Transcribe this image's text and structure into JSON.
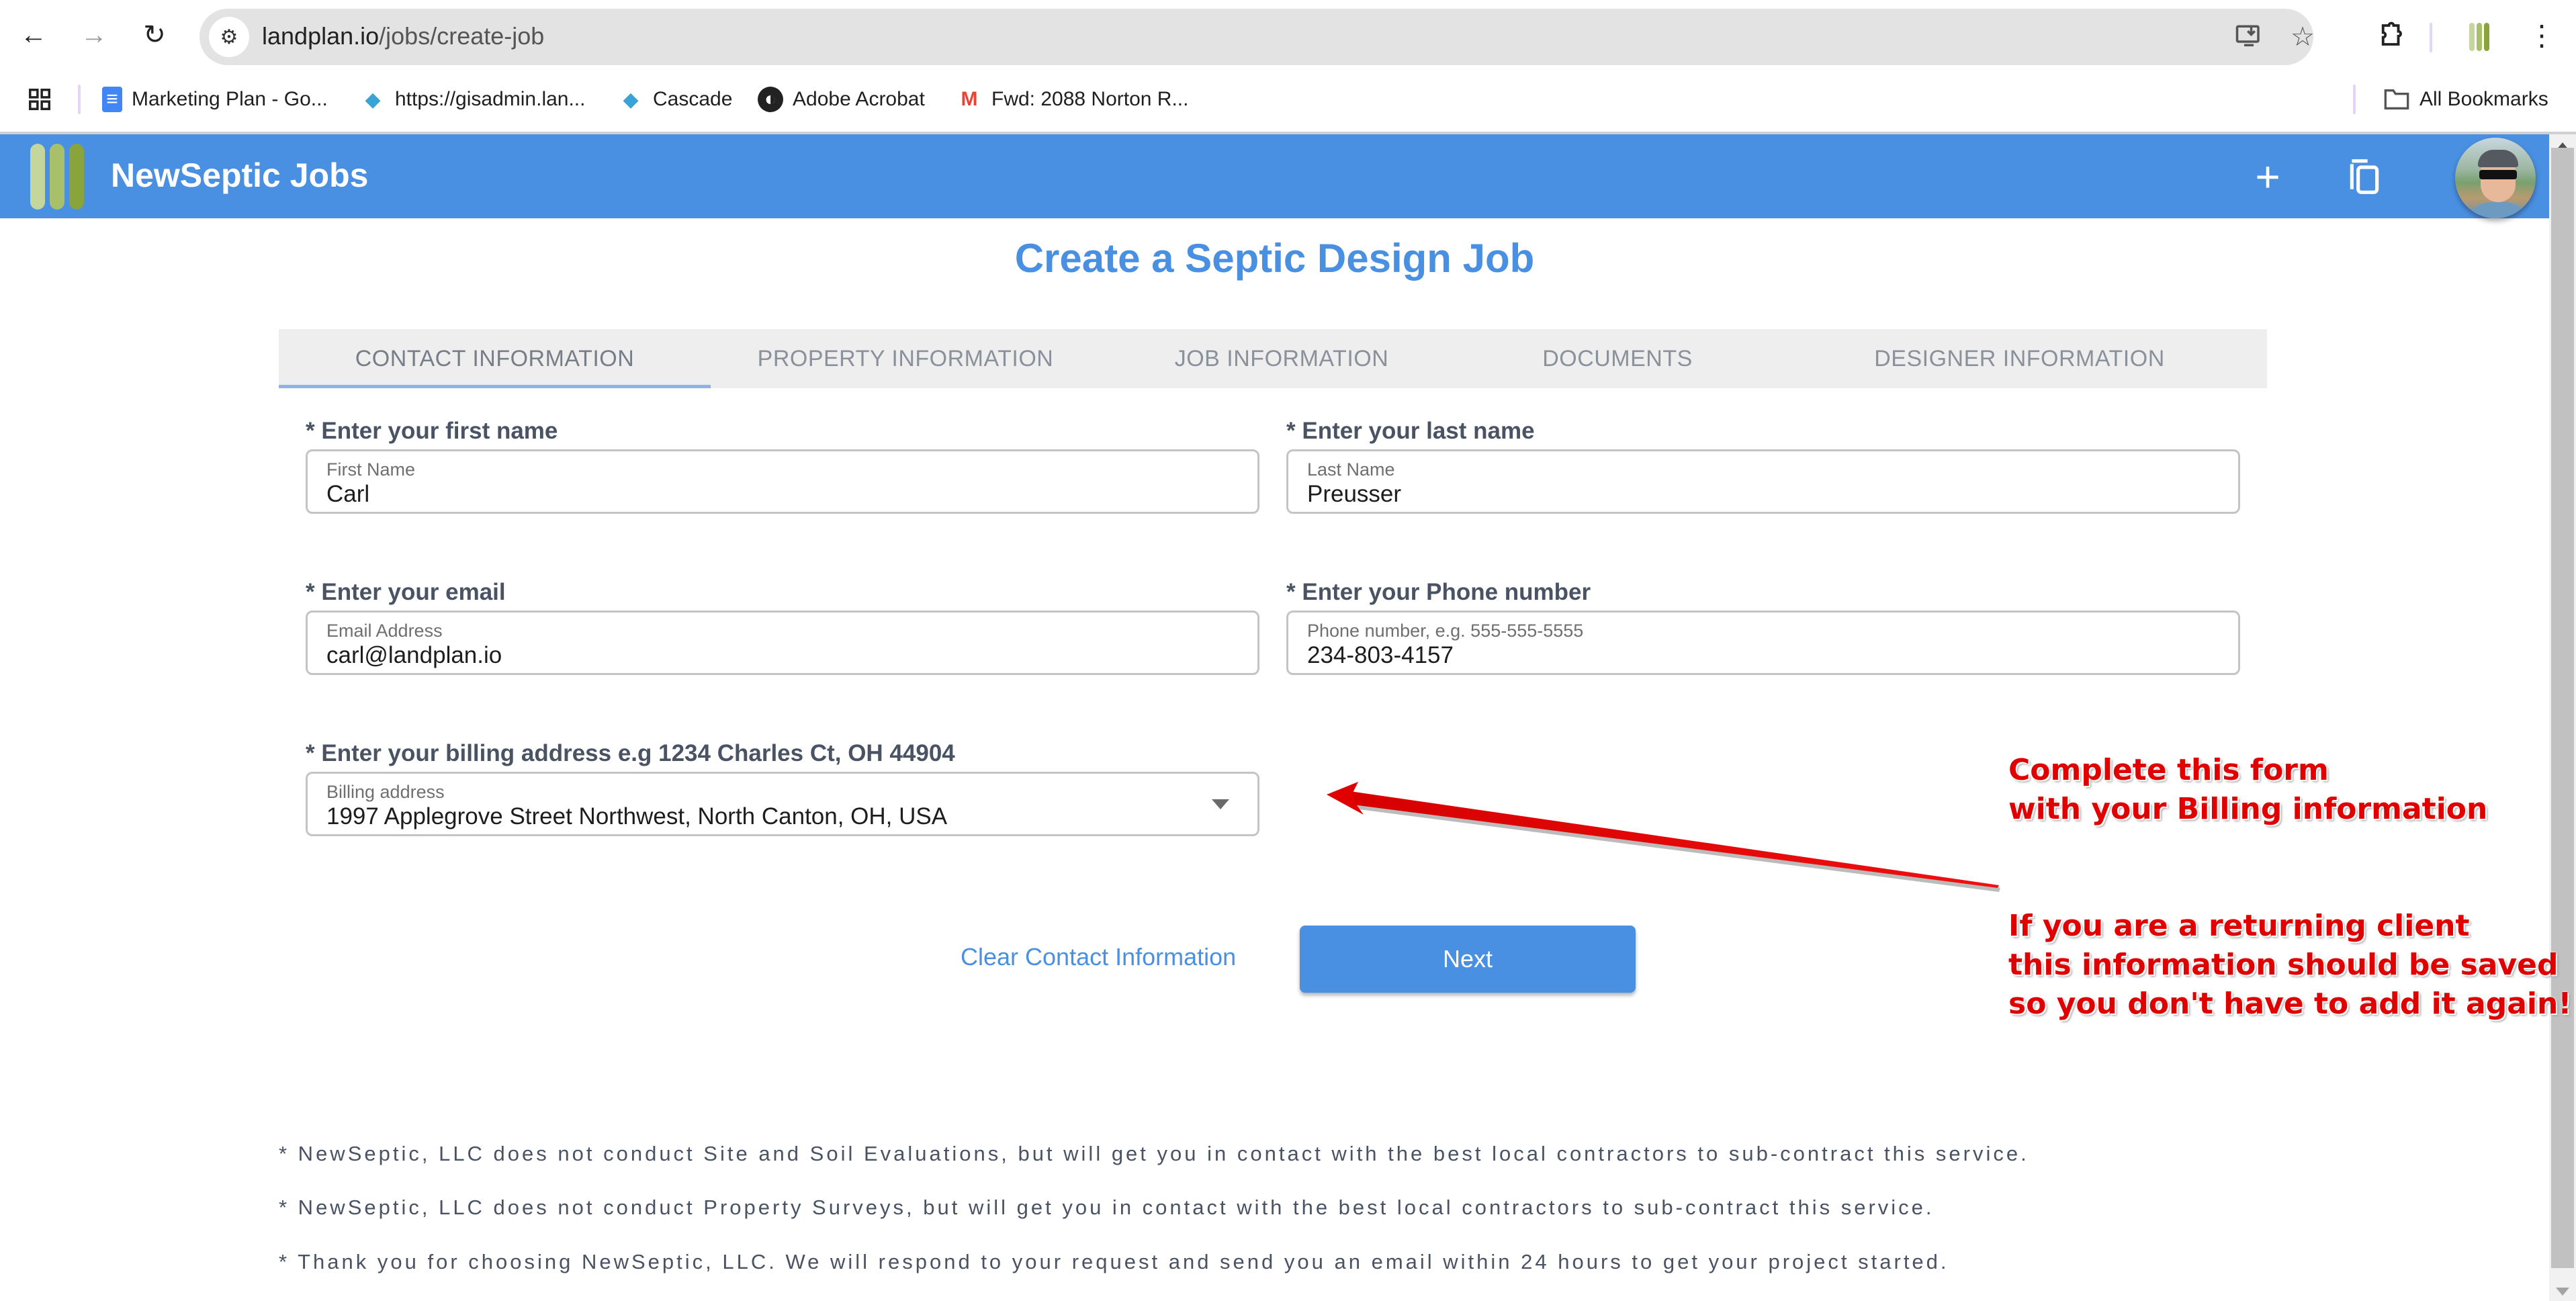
{
  "browser": {
    "url_host": "landplan.io",
    "url_path": "/jobs/create-job",
    "icons": {
      "back": "arrow-left-icon",
      "forward": "arrow-right-icon",
      "reload": "reload-icon",
      "site_info": "tune-icon",
      "install": "install-app-icon",
      "bookmark": "star-icon",
      "extensions": "puzzle-icon",
      "menu": "kebab-menu-icon"
    },
    "bookmarks": [
      {
        "label": "Marketing Plan - Go...",
        "icon": "google-docs-icon"
      },
      {
        "label": "https://gisadmin.lan...",
        "icon": "globe-icon"
      },
      {
        "label": "Cascade",
        "icon": "globe-icon"
      },
      {
        "label": "Adobe Acrobat",
        "icon": "acrobat-icon"
      },
      {
        "label": "Fwd: 2088 Norton R...",
        "icon": "gmail-icon"
      }
    ],
    "all_bookmarks_label": "All Bookmarks"
  },
  "app": {
    "title": "NewSeptic Jobs",
    "brand_color": "#4a90e2",
    "logo_colors": [
      "#c5d69c",
      "#a9c06a",
      "#8aa43c"
    ],
    "header_actions": [
      {
        "name": "add",
        "glyph": "+"
      },
      {
        "name": "copy",
        "glyph": "⧉"
      }
    ]
  },
  "page": {
    "title": "Create a Septic Design Job",
    "tabs": [
      {
        "label": "CONTACT INFORMATION",
        "active": true
      },
      {
        "label": "PROPERTY INFORMATION",
        "active": false
      },
      {
        "label": "JOB INFORMATION",
        "active": false
      },
      {
        "label": "DOCUMENTS",
        "active": false
      },
      {
        "label": "DESIGNER INFORMATION",
        "active": false
      }
    ],
    "form": {
      "first_name": {
        "label": "* Enter your first name",
        "floating": "First Name",
        "value": "Carl"
      },
      "last_name": {
        "label": "* Enter your last name",
        "floating": "Last Name",
        "value": "Preusser"
      },
      "email": {
        "label": "* Enter your email",
        "floating": "Email Address",
        "value": "carl@landplan.io"
      },
      "phone": {
        "label": "* Enter your Phone number",
        "floating": "Phone number, e.g. 555-555-5555",
        "value": "234-803-4157"
      },
      "billing": {
        "label": "* Enter your billing address e.g 1234 Charles Ct, OH 44904",
        "floating": "Billing address",
        "value": "1997 Applegrove Street Northwest, North Canton, OH, USA"
      }
    },
    "clear_label": "Clear Contact Information",
    "next_label": "Next",
    "notes": [
      "* NewSeptic, LLC does not conduct Site and Soil Evaluations, but will get you in contact with the best local contractors to sub-contract this service.",
      "* NewSeptic, LLC does not conduct Property Surveys, but will get you in contact with the best local contractors to sub-contract this service.",
      "* Thank you for choosing NewSeptic, LLC. We will respond to your request and send you an email within 24 hours to get your project started."
    ]
  },
  "annotation": {
    "color": "#e00000",
    "line1": "Complete this form",
    "line2": "with your Billing information",
    "line3": "If you are a returning client",
    "line4": "this information should be saved",
    "line5": "so you don't have to add it again!"
  }
}
